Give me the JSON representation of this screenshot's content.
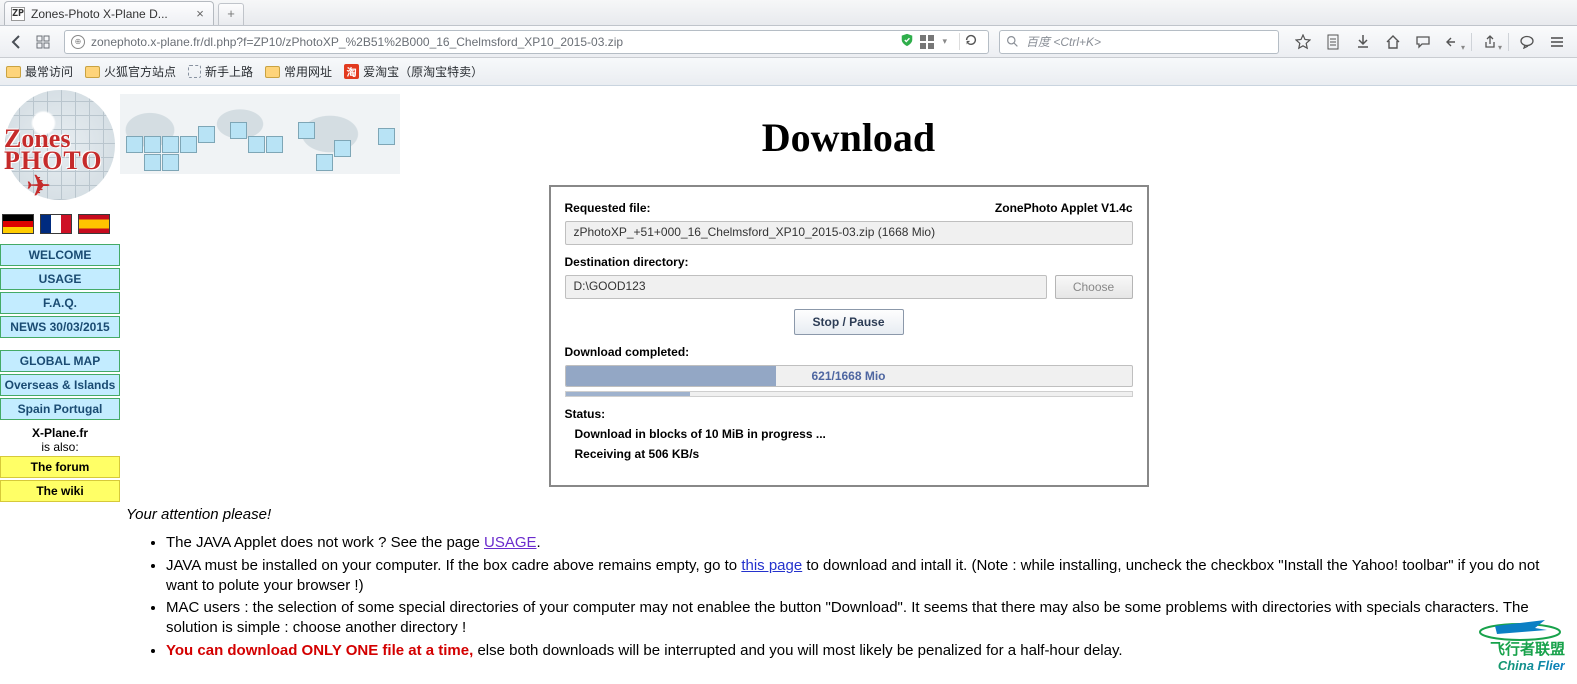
{
  "browser": {
    "tab_title": "Zones-Photo X-Plane D...",
    "url": "zonephoto.x-plane.fr/dl.php?f=ZP10/zPhotoXP_%2B51%2B000_16_Chelmsford_XP10_2015-03.zip",
    "search_placeholder": "百度 <Ctrl+K>",
    "bookmarks": {
      "most_visited": "最常访问",
      "firefox_official": "火狐官方站点",
      "getting_started": "新手上路",
      "common_sites": "常用网址",
      "taobao_icon": "淘",
      "taobao": "爱淘宝（原淘宝特卖）"
    }
  },
  "sidebar": {
    "logo_line1": "Zones",
    "logo_line2": "PHOTO",
    "menu": {
      "welcome": "WELCOME",
      "usage": "USAGE",
      "faq": "F.A.Q.",
      "news": "NEWS 30/03/2015",
      "global_map": "GLOBAL MAP",
      "overseas": "Overseas & Islands",
      "spain": "Spain Portugal"
    },
    "also_line1": "X-Plane.fr",
    "also_line2": "is also:",
    "forum": "The forum",
    "wiki": "The wiki"
  },
  "page": {
    "title": "Download",
    "applet": {
      "requested_label": "Requested file:",
      "version": "ZonePhoto Applet V1.4c",
      "requested_file": "zPhotoXP_+51+000_16_Chelmsford_XP10_2015-03.zip (1668 Mio)",
      "dest_label": "Destination directory:",
      "dest_value": "D:\\GOOD123",
      "choose": "Choose",
      "stop_pause": "Stop / Pause",
      "completed_label": "Download completed:",
      "progress_text": "621/1668 Mio",
      "progress_pct": 37.2,
      "thin_pct": 22,
      "status_label": "Status:",
      "status_line1": "Download in blocks of 10 MiB in progress ...",
      "status_line2": "Receiving at 506 KB/s"
    },
    "attention": {
      "heading": "Your attention please!",
      "b1a": "The JAVA Applet does not work ? See the page ",
      "b1link": "USAGE",
      "b1b": ".",
      "b2a": "JAVA must be installed on your computer. If the box cadre above remains empty, go to ",
      "b2link": "this page",
      "b2b": " to download and intall it. (Note : while installing, uncheck the checkbox \"Install the Yahoo! toolbar\" if you do not want to polute your browser !)",
      "b3": "MAC users : the selection of some special directories of your computer may not enablee the button \"Download\". It seems that there may also be some problems with directories with specials characters. The solution is simple : choose another directory !",
      "b4red": "You can download ONLY ONE file at a time,",
      "b4rest": " else both downloads will be interrupted and you will most likely be penalized for a half-hour delay."
    }
  },
  "watermark": {
    "cn": "飞行者联盟",
    "en": "China Flier"
  }
}
